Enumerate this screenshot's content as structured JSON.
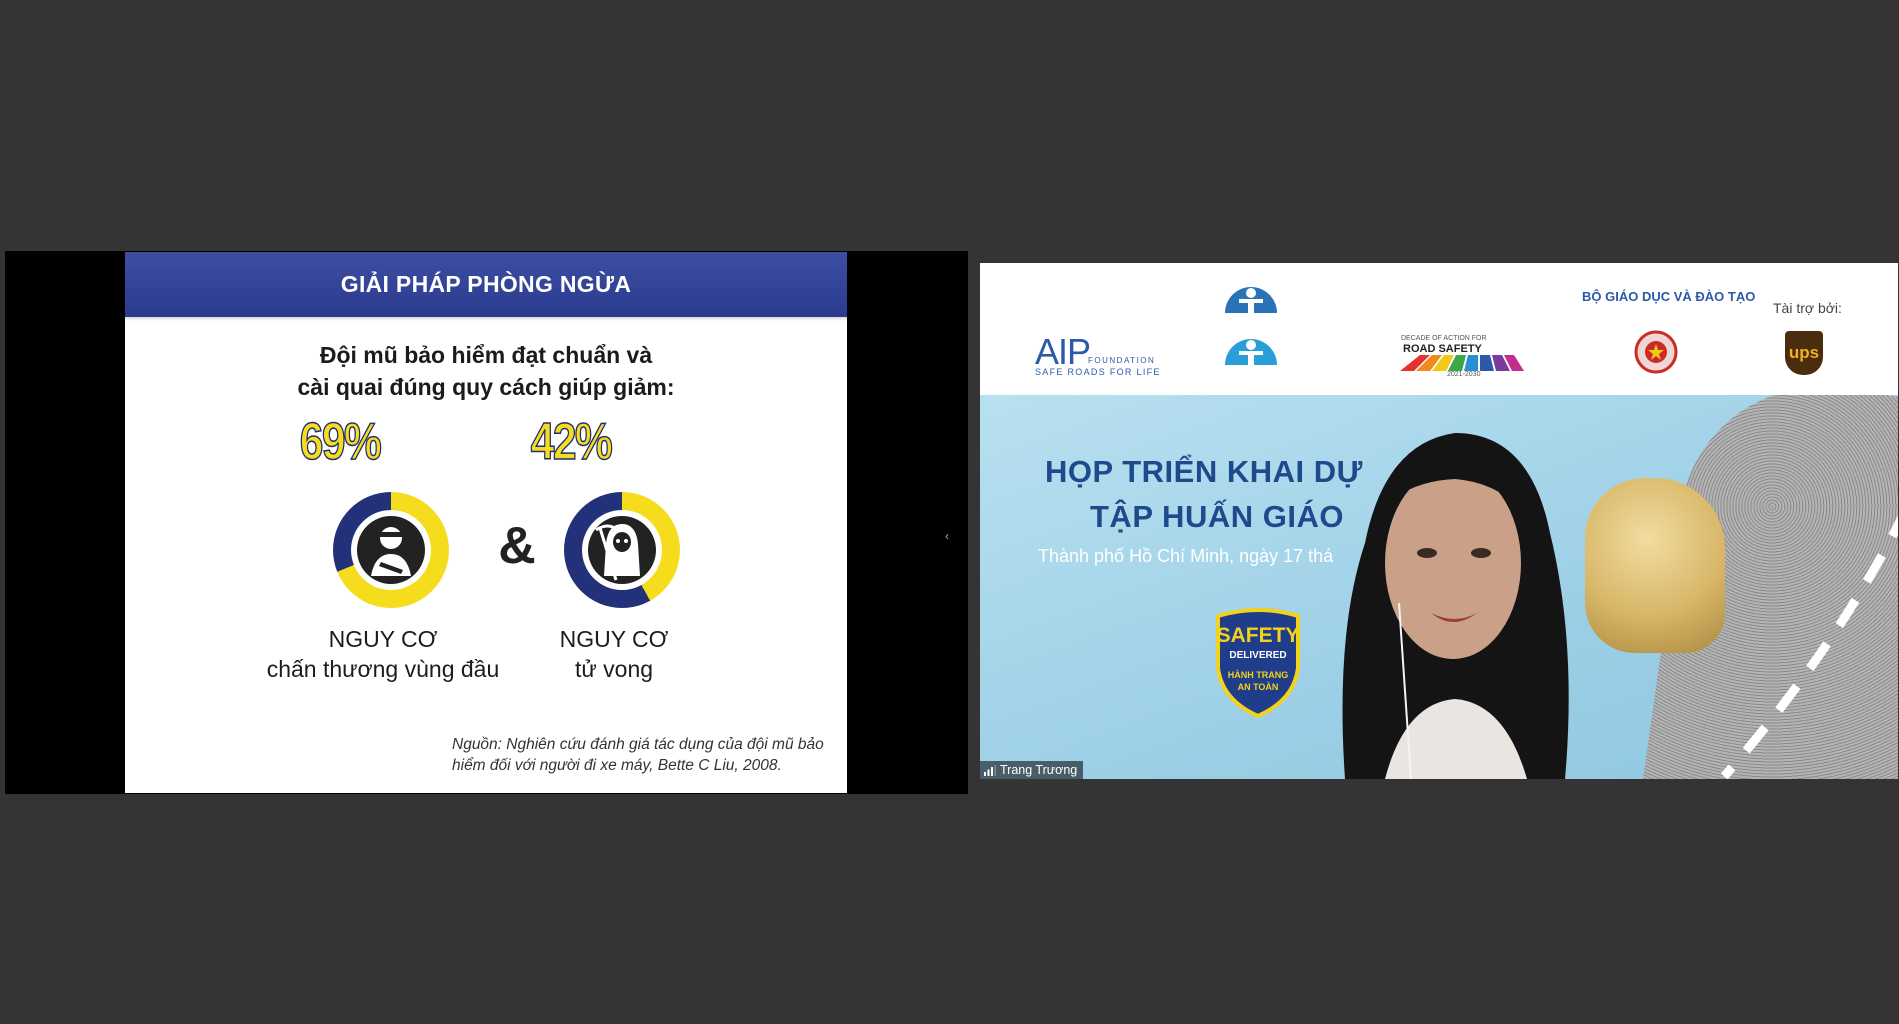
{
  "slide": {
    "header": "GIẢI PHÁP PHÒNG NGỪA",
    "headline_line1": "Đội mũ bảo hiểm đạt chuẩn và",
    "headline_line2": "cài quai đúng quy cách giúp giảm:",
    "stat_left": {
      "percent": "69%",
      "risk_line1": "NGUY CƠ",
      "risk_line2": "chấn thương vùng đầu",
      "ring_value": 0.69
    },
    "ampersand": "&",
    "stat_right": {
      "percent": "42%",
      "risk_line1": "NGUY CƠ",
      "risk_line2": "tử vong",
      "ring_value": 0.42
    },
    "source_line1": "Nguồn: Nghiên cứu đánh giá tác dụng của đội mũ bảo",
    "source_line2": "hiểm đối với người đi xe máy, Bette C Liu, 2008."
  },
  "video": {
    "participant_name": "Trang Trương",
    "sponsor_label": "Tài trợ bởi:",
    "ministry_label": "BỘ GIÁO DỤC VÀ ĐÀO TẠO",
    "aip_logo": "AIP",
    "aip_sub": "FOUNDATION",
    "aip_tagline": "SAFE ROADS FOR LIFE",
    "road_safety": "ROAD SAFETY",
    "decade_label": "DECADE OF ACTION FOR",
    "decade_years": "2021-2030",
    "ups_logo": "ups",
    "banner_title_line1": "HỌP TRIỂN KHAI DỰ",
    "banner_title_line2": "TẬP HUẤN GIÁO",
    "banner_subtitle": "Thành phố Hồ Chí Minh, ngày 17 thá",
    "badge_safety": "SAFETY",
    "badge_delivered": "DELIVERED",
    "badge_line1": "HÀNH TRANG",
    "badge_line2": "AN TOÀN"
  },
  "colors": {
    "app_background": "#343434",
    "slide_header": "#2f3f95",
    "stat_yellow": "#f5dd1e",
    "ring_navy": "#22317a",
    "banner_blue": "#9fd0e6"
  }
}
